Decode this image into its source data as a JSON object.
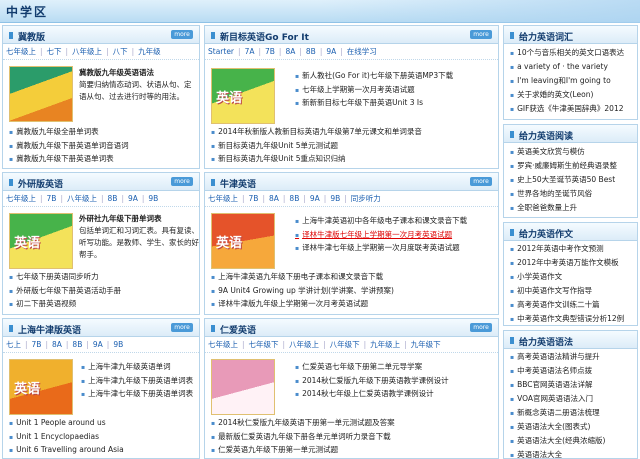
{
  "page": {
    "title": "中学区"
  },
  "more_label": "more",
  "p1": {
    "title": "冀教版",
    "nav": [
      "七年级上",
      "七下",
      "八年级上",
      "八下",
      "九年级"
    ],
    "feature_title": "冀教版九年级英语语法",
    "feature_desc": "简要归纳情态动词、状语从句、定语从句、过去进行时等的用法。",
    "list": [
      "冀教版九年级全册单词表",
      "冀教版九年级下册英语单词音语词",
      "冀教版九年级下册英语单词表"
    ]
  },
  "p2": {
    "title": "新目标英语Go For It",
    "nav": [
      "Starter",
      "7A",
      "7B",
      "8A",
      "8B",
      "9A",
      "在线学习"
    ],
    "top_list": [
      "新人教社(Go For it)七年级下册英语MP3下载",
      "七年级上学期第一次月考英语试题",
      "新新新目标七年级下册英语Unit 3 Is"
    ],
    "list": [
      "2014年秋新版人教新目标英语九年级第7单元课文和单词录音",
      "新目标英语九年级Unit 5单元测试题",
      "新目标英语九年级Unit 5重点知识归纳"
    ]
  },
  "p3": {
    "title": "外研版英语",
    "nav": [
      "七年级上",
      "7B",
      "八年级上",
      "8B",
      "9A",
      "9B"
    ],
    "feature_title": "外研社九年级下册单词表",
    "feature_desc": "包括单词汇和习词汇表。具有复读、听写功能。是教师、学生、家长的好帮手。",
    "list": [
      "七年级下册英语同步听力",
      "外研版七年级下册英语活动手册",
      "初二下册英语视频"
    ]
  },
  "p4": {
    "title": "牛津英语",
    "nav": [
      "七年级上",
      "7B",
      "8A",
      "8B",
      "9A",
      "9B",
      "同步听力"
    ],
    "top_list": [
      "上海牛津英语初中各年级电子课本和课文录音下载",
      "译林牛津版七年级上学期第一次月考英语试题",
      "译林牛津七年级上学期第一次月度联考英语试题"
    ],
    "highlight_index": 1,
    "list": [
      "上海牛津英语九年级下册电子课本和课文录音下载",
      "9A Unit4 Growing up 学讲计划(学讲案、学讲预案)",
      "译林牛津版九年级上学期第一次月考英语试题"
    ]
  },
  "p5": {
    "title": "上海牛津版英语",
    "nav": [
      "七上",
      "7B",
      "8A",
      "8B",
      "9A",
      "9B"
    ],
    "feature_list": [
      "上海牛津九年级英语单词",
      "上海牛津九年级下册英语单词表",
      "上海牛津七年级下册英语单词表"
    ],
    "list": [
      "Unit 1 People around us",
      "Unit 1 Encyclopaedias",
      "Unit 6 Travelling around Asia"
    ]
  },
  "p6": {
    "title": "仁爱英语",
    "nav": [
      "七年级上",
      "七年级下",
      "八年级上",
      "八年级下",
      "九年级上",
      "九年级下"
    ],
    "top_list": [
      "仁爱英语七年级下册第二单元导学案",
      "2014秋仁爱版九年级下册英语教学课例设计",
      "2014秋七年级上仁爱英语教学课例设计"
    ],
    "list": [
      "2014秋仁爱版九年级英语下册第一单元测试题及答案",
      "最新版仁爱英语九年级下册各单元单词听力录音下载",
      "仁爱英语九年级下册第一单元测试题"
    ]
  },
  "s1": {
    "title": "给力英语词汇",
    "items": [
      "10个与音乐相关的英文口语表达",
      "a variety of · the variety",
      "I'm leaving和I'm going to",
      "关于求婚的英文(Leon)",
      "GIF获选《牛津美国辞典》2012"
    ]
  },
  "s2": {
    "title": "给力英语阅读",
    "items": [
      "英语美文欣赏与模仿",
      "罗宾·威廉姆斯生前经典语录整",
      "史上50大圣诞节英语50 Best",
      "世界各地的圣诞节风俗",
      "全职爸爸数量上升"
    ]
  },
  "s3": {
    "title": "给力英语作文",
    "items": [
      "2012年英语中考作文预测",
      "2012年中考英语万能作文模板",
      "小学英语作文",
      "初中英语作文写作指导",
      "高考英语作文训练二十篇",
      "中考英语作文典型错误分析12例"
    ]
  },
  "s4": {
    "title": "给力英语语法",
    "items": [
      "高考英语语法精讲与提升",
      "中考英语语法名师点拨",
      "BBC官网英语语法详解",
      "VOA官网英语语法入门",
      "新概念英语二册语法梳理",
      "英语语法大全(图表式)",
      "英语语法大全(经典浓缩版)",
      "英语语法大全"
    ]
  },
  "colors": {
    "accent": "#1b5fb0",
    "header_bg": "#dcecf8",
    "border": "#b6d4ea",
    "link_red": "#dd0000"
  }
}
